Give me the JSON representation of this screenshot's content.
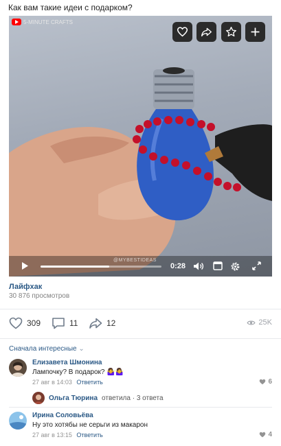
{
  "post": {
    "text": "Как вам такие идеи с подарком?"
  },
  "video": {
    "channel": "5-MINUTE CRAFTS",
    "watermark": "@MYBESTIDEAS",
    "time": "0:28",
    "progress_fraction": 0.57,
    "title": "Лайфхак",
    "views": "30 876 просмотров",
    "buttons": [
      "heart-icon",
      "share-icon",
      "star-icon",
      "plus-icon"
    ]
  },
  "actions": {
    "likes": "309",
    "comments": "11",
    "shares": "12",
    "views": "25K"
  },
  "comments_sort": {
    "label": "Сначала интересные",
    "chevron": "⌄"
  },
  "comments": [
    {
      "author": "Елизавета Шмонина",
      "text": "Лампочку? В подарок? 🤷‍♀️🤷‍♀️",
      "date": "27 авг в 14:03",
      "reply_label": "Ответить",
      "likes": "6"
    },
    {
      "author": "Ирина Соловьёва",
      "text": "Ну это хотябы не серьги из макарон",
      "date": "27 авг в 13:15",
      "reply_label": "Ответить",
      "likes": "4"
    }
  ],
  "reply_thread": {
    "author": "Ольга Тюрина",
    "info": "ответила · 3 ответа"
  },
  "colors": {
    "link": "#2a5885",
    "muted": "#828282",
    "youtube_red": "#ff0000"
  }
}
